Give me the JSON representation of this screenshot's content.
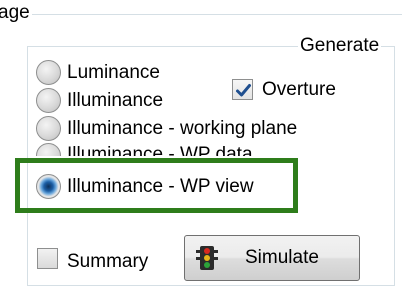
{
  "group": {
    "title_fragment": "age"
  },
  "generate": {
    "title": "Generate",
    "options": [
      {
        "label": "Luminance",
        "checked": false
      },
      {
        "label": "Illuminance",
        "checked": false
      },
      {
        "label": "Illuminance - working plane",
        "checked": false
      },
      {
        "label": "Illuminance - WP data",
        "checked": false
      },
      {
        "label": "Illuminance - WP view",
        "checked": true
      }
    ],
    "overture": {
      "label": "Overture",
      "checked": true
    }
  },
  "summary": {
    "label": "Summary",
    "checked": false
  },
  "simulate": {
    "label": "Simulate",
    "icon": "traffic-light-icon"
  },
  "colors": {
    "highlight": "#2e7d1b",
    "check": "#1f4f8f",
    "radio_selected": "#1d5fa5"
  }
}
